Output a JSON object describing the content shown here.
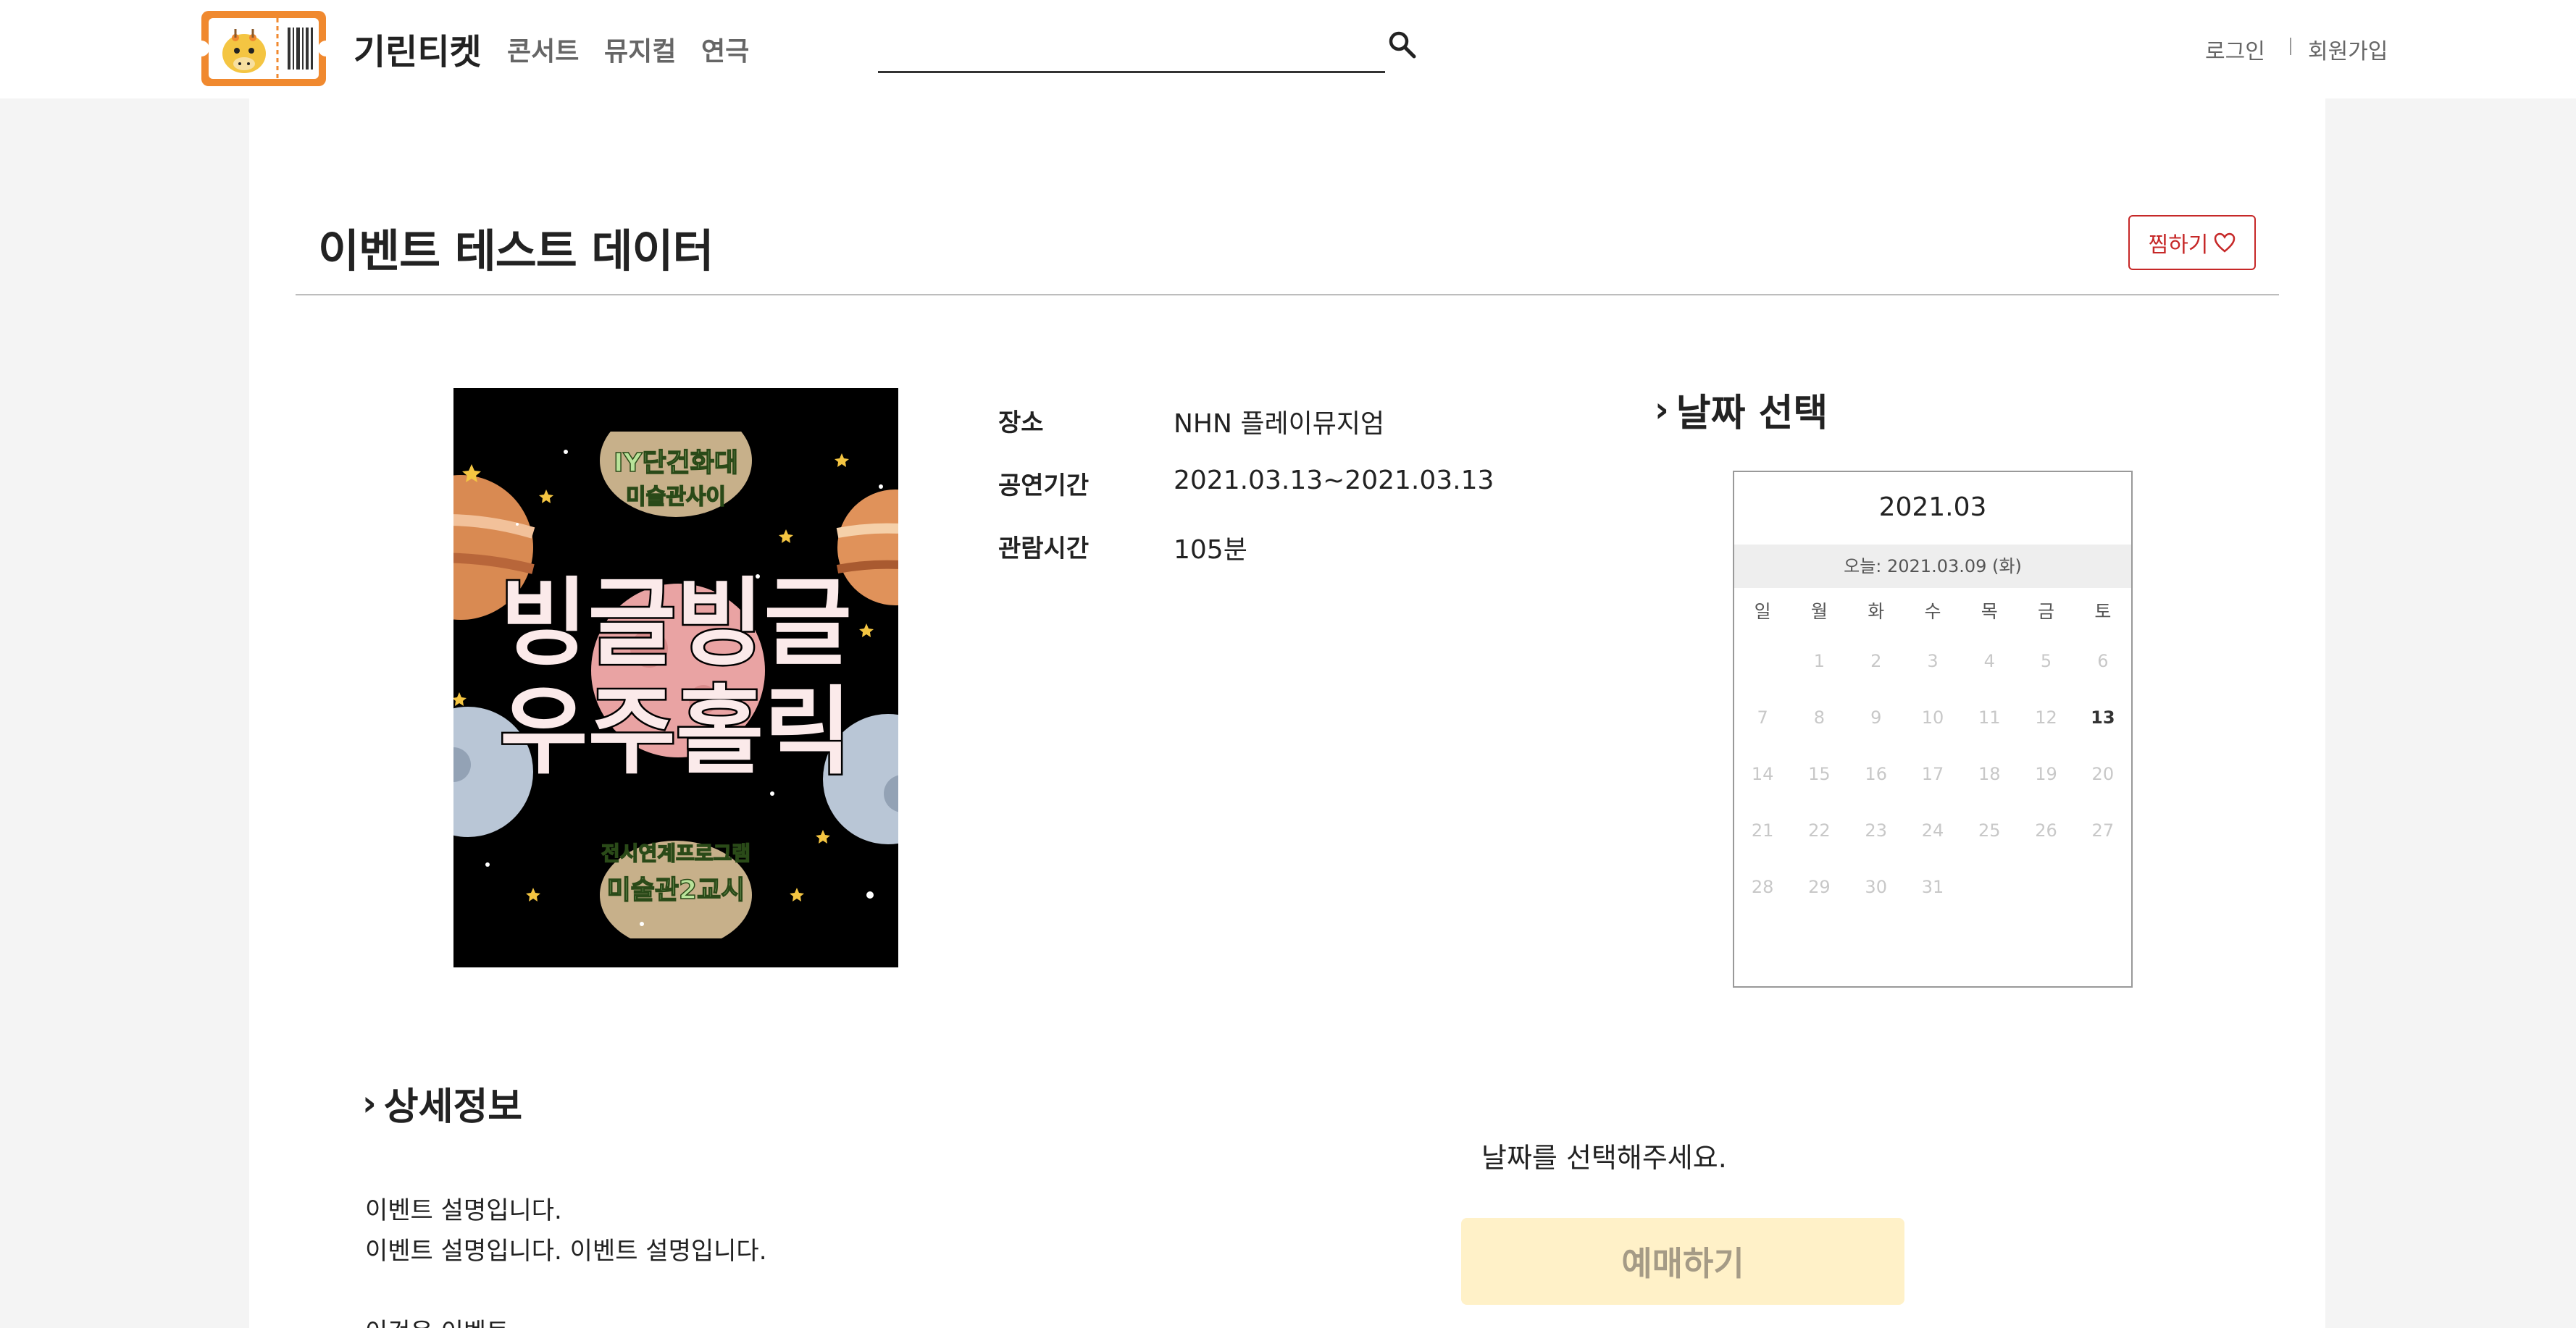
{
  "header": {
    "brand": "기린티켓",
    "nav": [
      "콘서트",
      "뮤지컬",
      "연극"
    ],
    "search_value": "",
    "login": "로그인",
    "signup": "회원가입"
  },
  "event": {
    "title": "이벤트 테스트 데이터",
    "wish_label": "찜하기",
    "poster": {
      "top_line1": "IY단건화대",
      "top_line2": "미술관사이",
      "main_line1": "빙글빙글",
      "main_line2": "우주홀릭",
      "bottom_line1": "전시연계프로그램",
      "bottom_line2": "미술관2교시"
    },
    "info": [
      {
        "label": "장소",
        "value": "NHN 플레이뮤지엄"
      },
      {
        "label": "공연기간",
        "value": "2021.03.13~2021.03.13"
      },
      {
        "label": "관람시간",
        "value": "105분"
      }
    ]
  },
  "calendar": {
    "section_title": "날짜 선택",
    "month": "2021.03",
    "today": "오늘: 2021.03.09 (화)",
    "weekdays": [
      "일",
      "월",
      "화",
      "수",
      "목",
      "금",
      "토"
    ],
    "weeks": [
      [
        "",
        "1",
        "2",
        "3",
        "4",
        "5",
        "6"
      ],
      [
        "7",
        "8",
        "9",
        "10",
        "11",
        "12",
        "13"
      ],
      [
        "14",
        "15",
        "16",
        "17",
        "18",
        "19",
        "20"
      ],
      [
        "21",
        "22",
        "23",
        "24",
        "25",
        "26",
        "27"
      ],
      [
        "28",
        "29",
        "30",
        "31",
        "",
        "",
        ""
      ]
    ],
    "available_day": "13"
  },
  "booking": {
    "select_message": "날짜를 선택해주세요.",
    "reserve_label": "예매하기"
  },
  "detail": {
    "section_title": "상세정보",
    "lines": [
      "이벤트 설명입니다.",
      "이벤트 설명입니다. 이벤트 설명입니다.",
      "",
      "이것은 이벤트"
    ]
  },
  "colors": {
    "accent_red": "#c62828",
    "reserve_bg": "#fff1c8",
    "logo_orange": "#f0892f"
  }
}
